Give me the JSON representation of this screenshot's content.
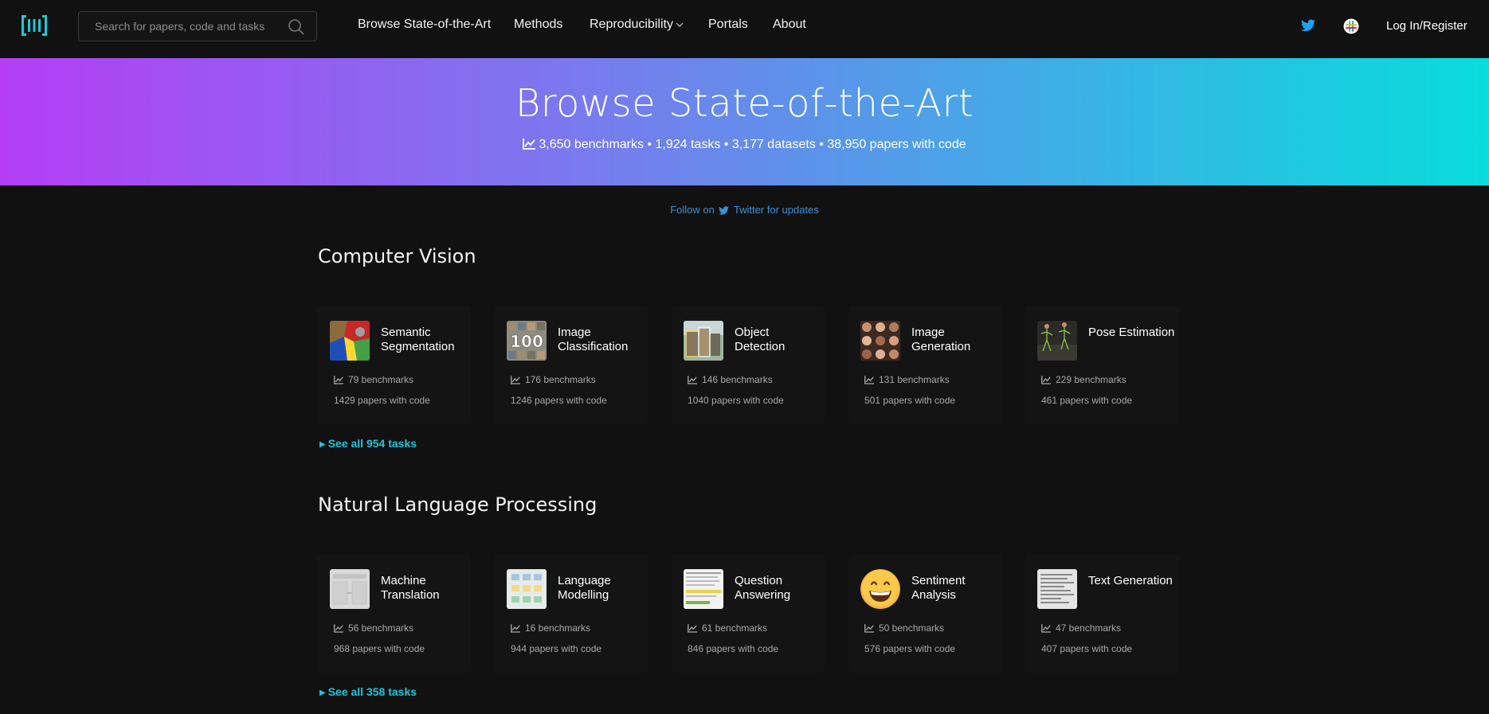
{
  "nav": {
    "search_placeholder": "Search for papers, code and tasks",
    "links": [
      "Browse State-of-the-Art",
      "Methods",
      "Reproducibility",
      "Portals",
      "About"
    ],
    "login": "Log In/Register"
  },
  "hero": {
    "title": "Browse State-of-the-Art",
    "stats": "3,650 benchmarks • 1,924 tasks • 3,177 datasets • 38,950 papers with code"
  },
  "follow": {
    "prefix": "Follow on",
    "suffix": "Twitter for updates"
  },
  "sections": [
    {
      "title": "Computer Vision",
      "see_all": "See all 954 tasks",
      "cards": [
        {
          "name": "Semantic Segmentation",
          "benchmarks": "79 benchmarks",
          "papers": "1429 papers with code"
        },
        {
          "name": "Image Classification",
          "benchmarks": "176 benchmarks",
          "papers": "1246 papers with code"
        },
        {
          "name": "Object Detection",
          "benchmarks": "146 benchmarks",
          "papers": "1040 papers with code"
        },
        {
          "name": "Image Generation",
          "benchmarks": "131 benchmarks",
          "papers": "501 papers with code"
        },
        {
          "name": "Pose Estimation",
          "benchmarks": "229 benchmarks",
          "papers": "461 papers with code"
        }
      ]
    },
    {
      "title": "Natural Language Processing",
      "see_all": "See all 358 tasks",
      "cards": [
        {
          "name": "Machine Translation",
          "benchmarks": "56 benchmarks",
          "papers": "968 papers with code"
        },
        {
          "name": "Language Modelling",
          "benchmarks": "16 benchmarks",
          "papers": "944 papers with code"
        },
        {
          "name": "Question Answering",
          "benchmarks": "61 benchmarks",
          "papers": "846 papers with code"
        },
        {
          "name": "Sentiment Analysis",
          "benchmarks": "50 benchmarks",
          "papers": "576 papers with code"
        },
        {
          "name": "Text Generation",
          "benchmarks": "47 benchmarks",
          "papers": "407 papers with code"
        }
      ]
    }
  ],
  "colors": {
    "background": "#111111",
    "accent": "#22c4d6",
    "twitter": "#1da1f2",
    "link": "#3d8fd8",
    "gradient_start": "#b43ef6",
    "gradient_end": "#08dcdc"
  },
  "icons": {
    "logo": "papers-with-code-logo",
    "search": "search-icon",
    "twitter": "twitter-icon",
    "slack": "slack-icon",
    "chart": "area-chart-icon"
  }
}
